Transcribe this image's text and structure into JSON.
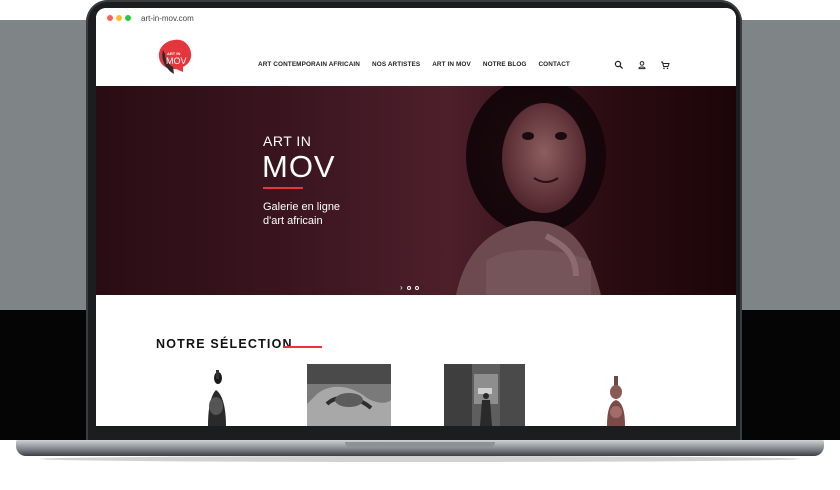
{
  "browser": {
    "url": "art-in-mov.com",
    "dots": [
      "#ff5f57",
      "#febc2e",
      "#28c840"
    ]
  },
  "logo": {
    "text_top": "ART IN",
    "text_main": "MOV",
    "color": "#e4363d"
  },
  "nav": {
    "items": [
      "ART CONTEMPORAIN AFRICAIN",
      "NOS ARTISTES",
      "ART IN MOV",
      "NOTRE BLOG",
      "CONTACT"
    ]
  },
  "header_icons": [
    "search-icon",
    "account-icon",
    "cart-icon"
  ],
  "hero": {
    "brand_line1": "ART IN",
    "brand_line2": "MOV",
    "subtitle_line1": "Galerie en ligne",
    "subtitle_line2": "d'art africain",
    "accent": "#e4363d",
    "slider_next": "›"
  },
  "selection": {
    "title": "NOTRE SÉLECTION"
  }
}
